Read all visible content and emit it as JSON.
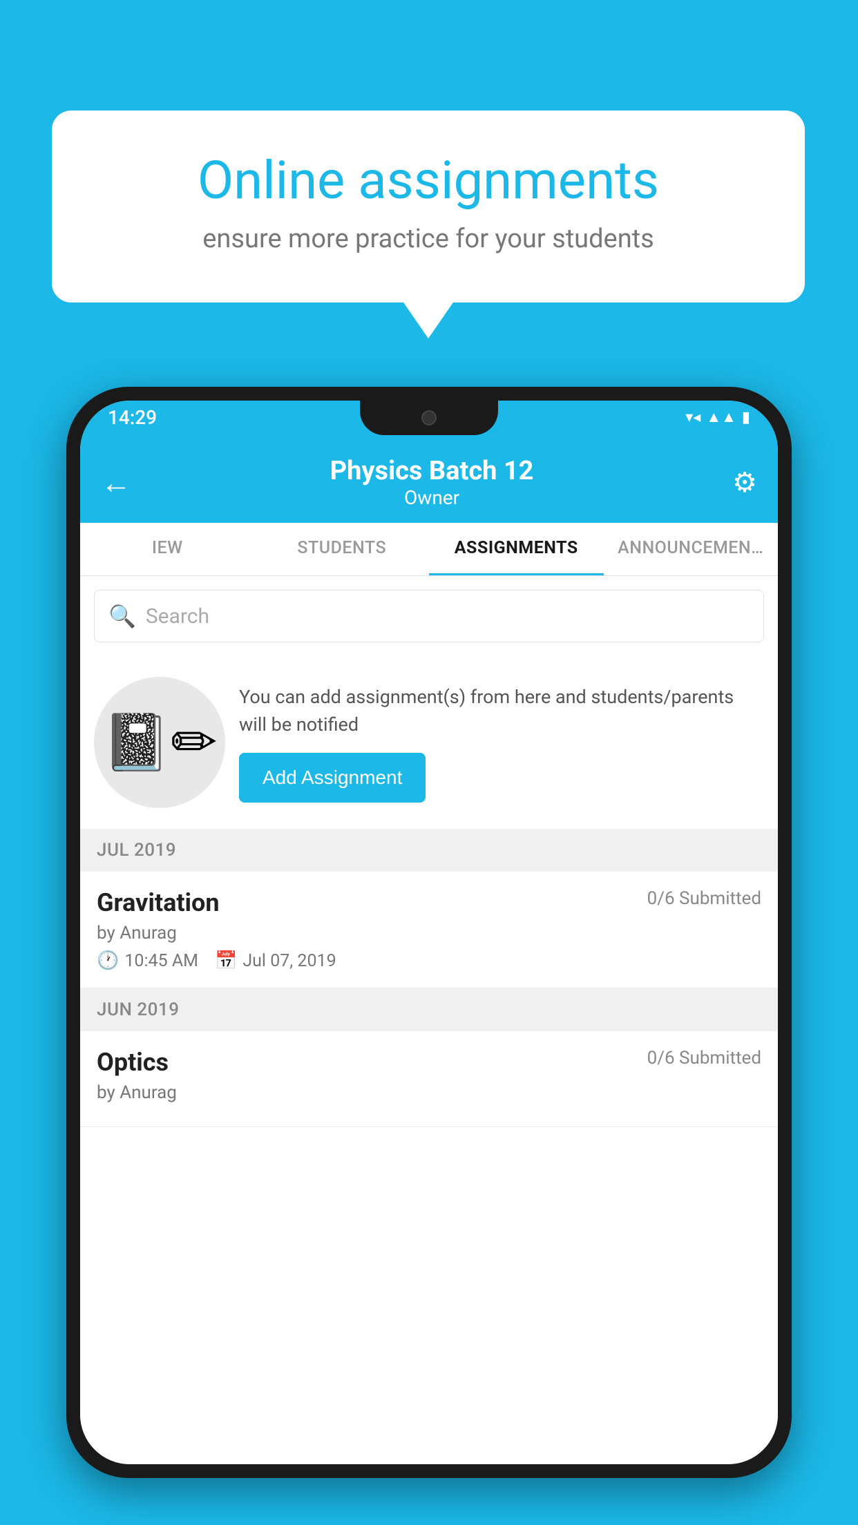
{
  "background": {
    "color": "#1bb8e8"
  },
  "speech_bubble": {
    "title": "Online assignments",
    "subtitle": "ensure more practice for your students"
  },
  "status_bar": {
    "time": "14:29",
    "icons": [
      "wifi",
      "signal",
      "battery"
    ]
  },
  "app_header": {
    "title": "Physics Batch 12",
    "subtitle": "Owner",
    "back_label": "←",
    "settings_label": "⚙"
  },
  "tabs": [
    {
      "label": "IEW",
      "active": false
    },
    {
      "label": "STUDENTS",
      "active": false
    },
    {
      "label": "ASSIGNMENTS",
      "active": true
    },
    {
      "label": "ANNOUNCEMENTS",
      "active": false
    }
  ],
  "search": {
    "placeholder": "Search"
  },
  "empty_state": {
    "description": "You can add assignment(s) from here and students/parents will be notified",
    "button_label": "Add Assignment"
  },
  "sections": [
    {
      "month": "JUL 2019",
      "assignments": [
        {
          "name": "Gravitation",
          "submitted": "0/6 Submitted",
          "author": "by Anurag",
          "time": "10:45 AM",
          "date": "Jul 07, 2019"
        }
      ]
    },
    {
      "month": "JUN 2019",
      "assignments": [
        {
          "name": "Optics",
          "submitted": "0/6 Submitted",
          "author": "by Anurag",
          "time": "",
          "date": ""
        }
      ]
    }
  ]
}
